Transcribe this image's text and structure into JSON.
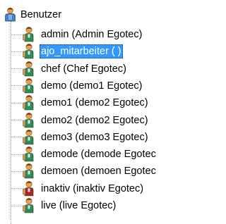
{
  "tree": {
    "root": {
      "label": "Benutzer",
      "icon": "users-group-icon"
    },
    "items": [
      {
        "label": "admin (Admin Egotec)",
        "icon": "user-icon",
        "selected": false,
        "status_color": "#2e8b57"
      },
      {
        "label": "ajo_mitarbeiter ( )",
        "icon": "user-icon",
        "selected": true,
        "status_color": "#2e8b57"
      },
      {
        "label": "chef (Chef Egotec)",
        "icon": "user-icon",
        "selected": false,
        "status_color": "#2e8b57"
      },
      {
        "label": "demo (demo1 Egotec)",
        "icon": "user-icon",
        "selected": false,
        "status_color": "#2e8b57"
      },
      {
        "label": "demo1 (demo2 Egotec)",
        "icon": "user-icon",
        "selected": false,
        "status_color": "#2e8b57"
      },
      {
        "label": "demo2 (demo2 Egotec)",
        "icon": "user-icon",
        "selected": false,
        "status_color": "#2e8b57"
      },
      {
        "label": "demo3 (demo3 Egotec)",
        "icon": "user-icon",
        "selected": false,
        "status_color": "#2e8b57"
      },
      {
        "label": "demode (demode Egotec",
        "icon": "user-icon",
        "selected": false,
        "status_color": "#2e8b57"
      },
      {
        "label": "demoen (demoen Egotec",
        "icon": "user-icon",
        "selected": false,
        "status_color": "#2e8b57"
      },
      {
        "label": "inaktiv (inaktiv Egotec)",
        "icon": "user-inactive-icon",
        "selected": false,
        "status_color": "#b22222"
      },
      {
        "label": "live (live Egotec)",
        "icon": "user-icon",
        "selected": false,
        "status_color": "#2e8b57"
      }
    ]
  },
  "colors": {
    "selection": "#3399ff",
    "selection_text": "#ffffff",
    "skin": "#e8a04a",
    "hair": "#6b3a10",
    "active_body": "#2e8b57",
    "inactive_body": "#b22222",
    "group_blue": "#4a7fc1"
  }
}
